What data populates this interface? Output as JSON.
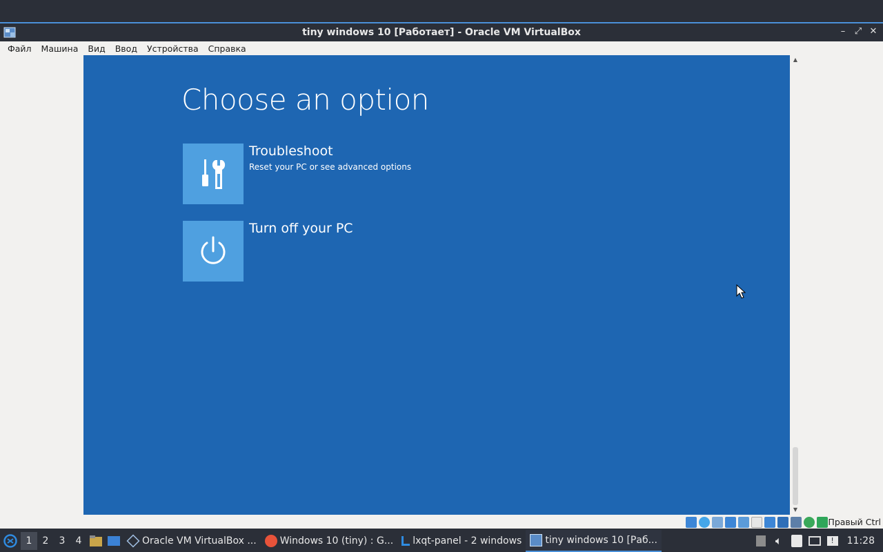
{
  "window": {
    "title": "tiny windows 10 [Работает] - Oracle VM VirtualBox",
    "controls": [
      "minimize",
      "restore",
      "close"
    ]
  },
  "menubar": [
    "Файл",
    "Машина",
    "Вид",
    "Ввод",
    "Устройства",
    "Справка"
  ],
  "vm": {
    "heading": "Choose an option",
    "options": [
      {
        "title": "Troubleshoot",
        "subtitle": "Reset your PC or see advanced options",
        "icon": "tools-icon"
      },
      {
        "title": "Turn off your PC",
        "subtitle": "",
        "icon": "power-icon"
      }
    ],
    "background_color": "#1e66b2",
    "tile_color": "#4fa0e0"
  },
  "statusbar": {
    "host_key": "Правый Ctrl"
  },
  "taskbar": {
    "desktops": [
      "1",
      "2",
      "3",
      "4"
    ],
    "active_desktop": "1",
    "tasks": [
      {
        "label": "Oracle VM VirtualBox ...",
        "icon": "virtualbox-icon"
      },
      {
        "label": "Windows 10 (tiny) : G...",
        "icon": "firefox-icon"
      },
      {
        "label": "lxqt-panel - 2 windows",
        "icon": "lxqt-icon"
      },
      {
        "label": "tiny windows 10 [Раб...",
        "icon": "virtualbox-vm-icon"
      }
    ],
    "clock": "11:28"
  }
}
